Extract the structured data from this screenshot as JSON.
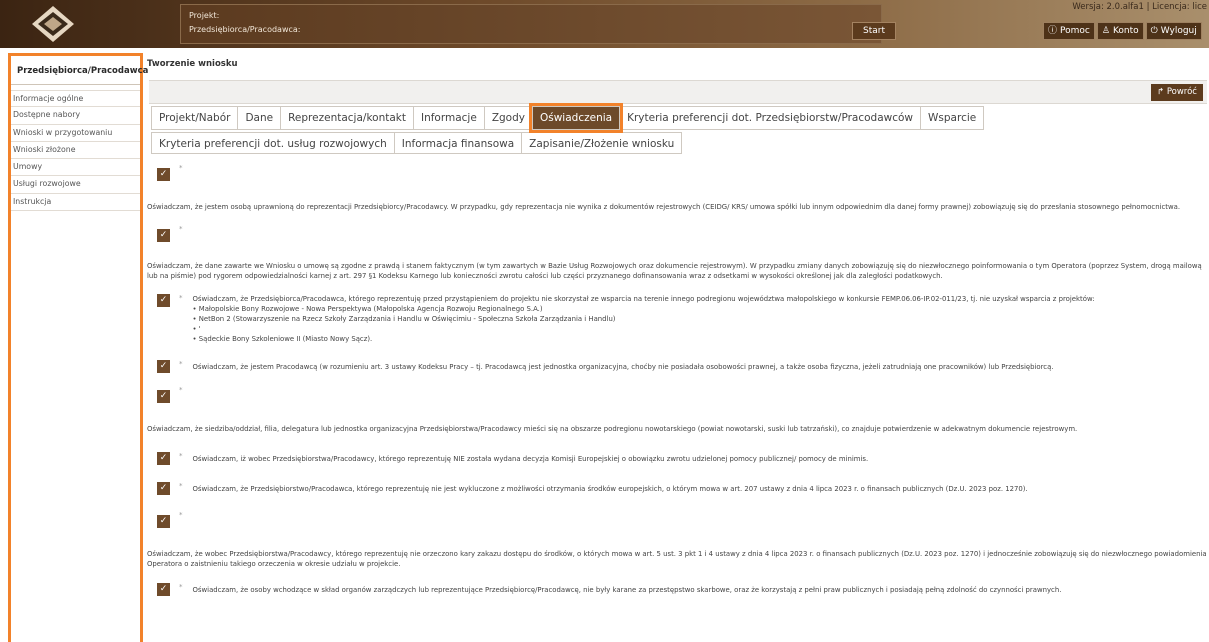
{
  "header": {
    "project_label": "Projekt:",
    "employer_label": "Przedsiębiorca/Pracodawca:",
    "start": "Start",
    "version": "Wersja: 2.0.alfa1 | Licencja: lice",
    "help": "Pomoc",
    "account": "Konto",
    "logout": "Wyloguj"
  },
  "sidebar": {
    "title": "Przedsiębiorca/Pracodawca",
    "items": [
      "Informacje ogólne",
      "Dostępne nabory",
      "Wnioski w przygotowaniu",
      "Wnioski złożone",
      "Umowy",
      "Usługi rozwojowe",
      "Instrukcja"
    ]
  },
  "main": {
    "title": "Tworzenie wniosku",
    "back": "Powróć",
    "tabs_row1": [
      "Projekt/Nabór",
      "Dane",
      "Reprezentacja/kontakt",
      "Informacje",
      "Zgody",
      "Oświadczenia",
      "Kryteria preferencji dot. Przedsiębiorstw/Pracodawców",
      "Wsparcie"
    ],
    "tabs_row2": [
      "Kryteria preferencji dot. usług rozwojowych",
      "Informacja finansowa",
      "Zapisanie/Złożenie wniosku"
    ],
    "active_tab": "Oświadczenia"
  },
  "statements": {
    "s1": "Oświadczam, że jestem osobą uprawnioną do reprezentacji Przedsiębiorcy/Pracodawcy. W przypadku, gdy reprezentacja nie wynika z dokumentów rejestrowych (CEIDG/ KRS/ umowa spółki lub innym odpowiednim dla danej formy prawnej) zobowiązuję się do przesłania stosownego pełnomocnictwa.",
    "s2": "Oświadczam, że dane zawarte we Wniosku o umowę są zgodne z prawdą i stanem faktycznym (w tym zawartych w Bazie Usług Rozwojowych oraz dokumencie rejestrowym). W przypadku zmiany danych zobowiązuję się do niezwłocznego poinformowania o tym Operatora (poprzez System, drogą mailową lub na piśmie) pod rygorem odpowiedzialności karnej z art. 297 §1 Kodeksu Karnego lub konieczności zwrotu całości lub części przyznanego dofinansowania wraz z odsetkami w wysokości określonej jak dla zaległości podatkowych.",
    "s3": "Oświadczam, że Przedsiębiorca/Pracodawca, którego reprezentuję przed przystąpieniem do projektu nie skorzystał ze wsparcia na terenie innego podregionu województwa małopolskiego w konkursie FEMP.06.06-IP.02-011/23, tj. nie uzyskał wsparcia z projektów:",
    "s3_list": [
      "• Małopolskie Bony Rozwojowe - Nowa Perspektywa (Małopolska Agencja Rozwoju Regionalnego S.A.)",
      "• NetBon 2 (Stowarzyszenie na Rzecz Szkoły Zarządzania i Handlu w Oświęcimiu - Społeczna Szkoła Zarządzania i Handlu)",
      "• '",
      "• Sądeckie Bony Szkoleniowe II (Miasto Nowy Sącz)."
    ],
    "s4": "Oświadczam, że jestem Pracodawcą (w rozumieniu art. 3 ustawy Kodeksu Pracy – tj. Pracodawcą jest jednostka organizacyjna, choćby nie posiadała osobowości prawnej, a także osoba fizyczna, jeżeli zatrudniają one pracowników) lub Przedsiębiorcą.",
    "s5": "Oświadczam, że siedziba/oddział, filia, delegatura lub jednostka organizacyjna Przedsiębiorstwa/Pracodawcy mieści się na obszarze podregionu nowotarskiego (powiat nowotarski, suski lub tatrzański), co znajduje potwierdzenie w adekwatnym dokumencie rejestrowym.",
    "s6": "Oświadczam, iż wobec Przedsiębiorstwa/Pracodawcy, którego reprezentuję NIE została wydana decyzja Komisji Europejskiej o obowiązku zwrotu udzielonej pomocy publicznej/ pomocy de minimis.",
    "s7": "Oświadczam, że Przedsiębiorstwo/Pracodawca, którego reprezentuję nie jest wykluczone z możliwości otrzymania środków europejskich, o którym mowa w art. 207 ustawy z dnia 4 lipca 2023 r. o finansach publicznych (Dz.U. 2023 poz. 1270).",
    "s8": "Oświadczam, że wobec Przedsiębiorstwa/Pracodawcy, którego reprezentuję nie orzeczono kary zakazu dostępu do środków, o których mowa w art. 5 ust. 3 pkt 1 i 4 ustawy z dnia 4 lipca 2023 r. o finansach publicznych (Dz.U. 2023 poz. 1270) i jednocześnie zobowiązuję się do niezwłocznego powiadomienia Operatora o zaistnieniu takiego orzeczenia w okresie udziału w projekcie.",
    "s9": "Oświadczam, że osoby wchodzące w skład organów zarządczych lub reprezentujące Przedsiębiorcę/Pracodawcę, nie były karane za przestępstwo skarbowe, oraz że korzystają z pełni praw publicznych i posiadają pełną zdolność do czynności prawnych.",
    "required": "*",
    "check": "✓"
  },
  "colors": {
    "accent": "#f2822a",
    "brand": "#6d4a2a"
  }
}
